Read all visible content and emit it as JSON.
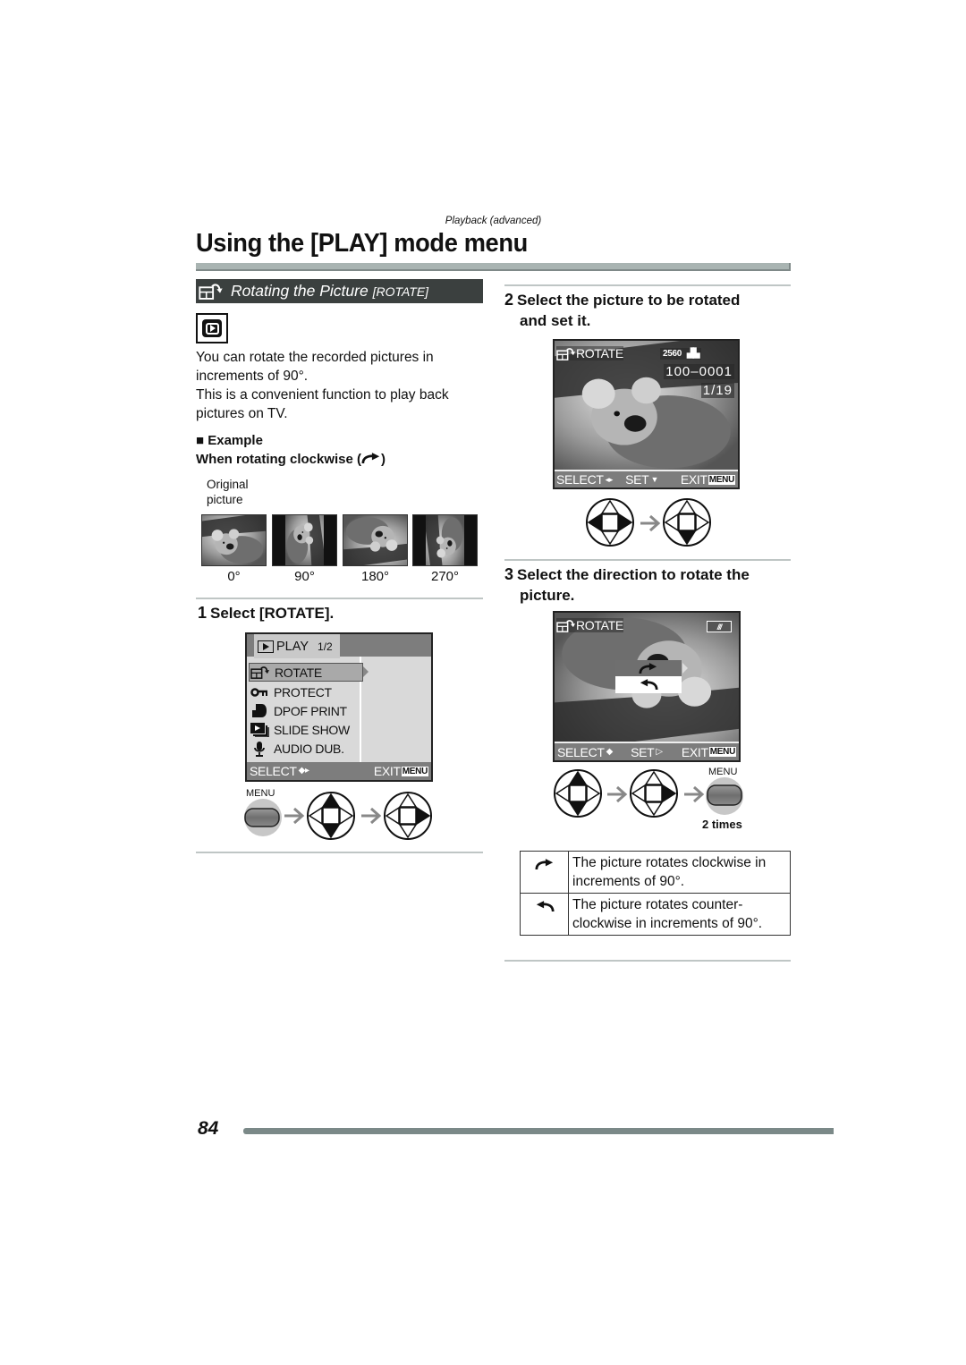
{
  "header": {
    "running_head": "Playback (advanced)",
    "title": "Using the [PLAY] mode menu"
  },
  "section": {
    "icon": "rotate-icon",
    "title": "Rotating the Picture ",
    "title_suffix": "[ROTATE]"
  },
  "mode_icon": "playback-mode-icon",
  "intro": {
    "p1": "You can rotate the recorded pictures in increments of 90°.",
    "p2": "This is a convenient function to play back pictures on TV."
  },
  "example": {
    "heading": "■ Example",
    "subheading_prefix": "When rotating clockwise (",
    "subheading_suffix": ")",
    "original_label_1": "Original",
    "original_label_2": "picture",
    "thumbnails": [
      {
        "label": "0°",
        "rotation": 0
      },
      {
        "label": "90°",
        "rotation": 90
      },
      {
        "label": "180°",
        "rotation": 180
      },
      {
        "label": "270°",
        "rotation": 270
      }
    ]
  },
  "step1": {
    "number": "1",
    "text": "Select [ROTATE].",
    "menu_screen": {
      "tab_label": "PLAY",
      "page": "1/2",
      "items": [
        {
          "icon": "rotate-icon",
          "label": "ROTATE",
          "selected": true
        },
        {
          "icon": "key-icon",
          "label": "PROTECT",
          "selected": false
        },
        {
          "icon": "print-icon",
          "label": "DPOF PRINT",
          "selected": false
        },
        {
          "icon": "slideshow-icon",
          "label": "SLIDE SHOW",
          "selected": false
        },
        {
          "icon": "microphone-icon",
          "label": "AUDIO DUB.",
          "selected": false
        }
      ],
      "footer_select": "SELECT",
      "footer_exit": "EXIT",
      "footer_menu": "MENU"
    },
    "sequence_menu_label": "MENU"
  },
  "step2": {
    "number": "2",
    "text_line1": "Select the picture to be rotated",
    "text_line2": "and set it.",
    "screen": {
      "mode_label": "ROTATE",
      "resolution": "2560",
      "file_number": "100–0001",
      "frame": "1/19",
      "footer_select": "SELECT",
      "footer_set": "SET",
      "footer_exit": "EXIT",
      "footer_menu": "MENU"
    }
  },
  "step3": {
    "number": "3",
    "text_line1": "Select the direction to rotate the",
    "text_line2": "picture.",
    "screen": {
      "mode_label": "ROTATE",
      "options": [
        "clockwise",
        "counter-clockwise"
      ],
      "footer_select": "SELECT",
      "footer_set": "SET",
      "footer_exit": "EXIT",
      "footer_menu": "MENU"
    },
    "sequence_menu_label": "MENU",
    "times_label": "2 times"
  },
  "direction_table": [
    {
      "icon": "clockwise-arrow-icon",
      "text": "The picture rotates clockwise in increments of 90°."
    },
    {
      "icon": "counterclockwise-arrow-icon",
      "text": "The picture rotates counter-clockwise in increments of 90°."
    }
  ],
  "footer": {
    "page_number": "84"
  }
}
